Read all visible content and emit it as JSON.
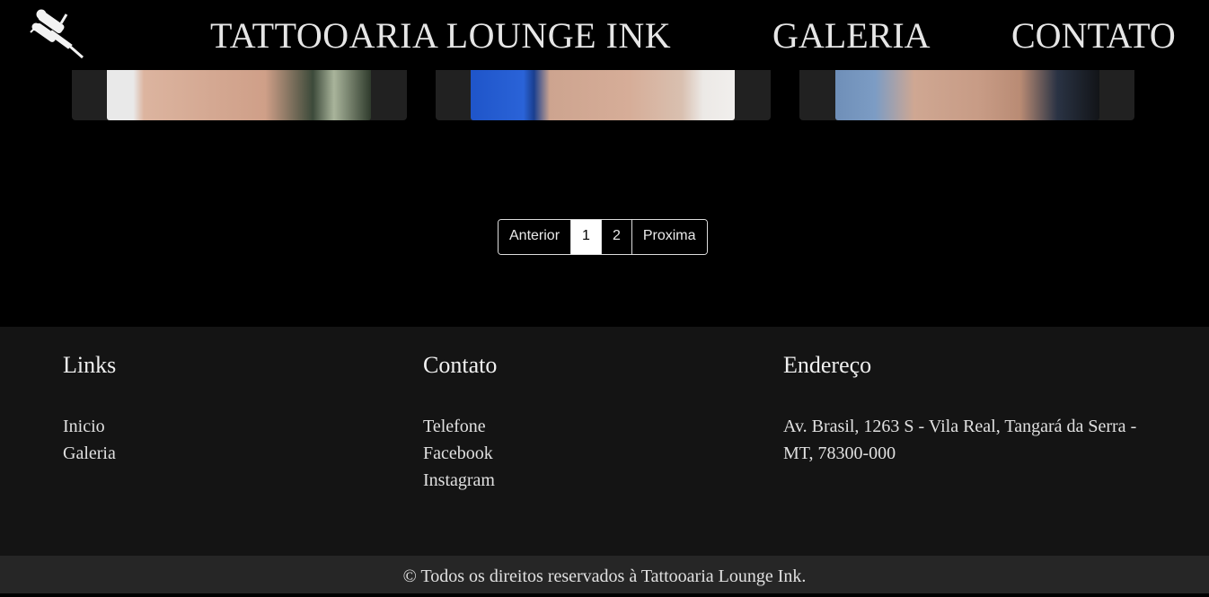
{
  "header": {
    "brand": "TATTOOARIA LOUNGE INK",
    "nav": [
      "GALERIA",
      "CONTATO"
    ]
  },
  "pagination": {
    "previous": "Anterior",
    "pages": [
      "1",
      "2"
    ],
    "active_page": "1",
    "next": "Proxima"
  },
  "footer": {
    "links": {
      "title": "Links",
      "items": [
        "Inicio",
        "Galeria"
      ]
    },
    "contact": {
      "title": "Contato",
      "items": [
        "Telefone",
        "Facebook",
        "Instagram"
      ]
    },
    "address": {
      "title": "Endereço",
      "text": "Av. Brasil, 1263 S - Vila Real, Tangará da Serra - MT, 78300-000"
    },
    "copyright": "© Todos os direitos reservados à Tattooaria Lounge Ink."
  },
  "colors": {
    "background": "#000000",
    "footer_bg": "#141414",
    "copyright_bg": "#262626",
    "card_bg": "#212121",
    "text": "#e6e6e6"
  },
  "icons": {
    "logo": "tattoo-machine-icon"
  }
}
